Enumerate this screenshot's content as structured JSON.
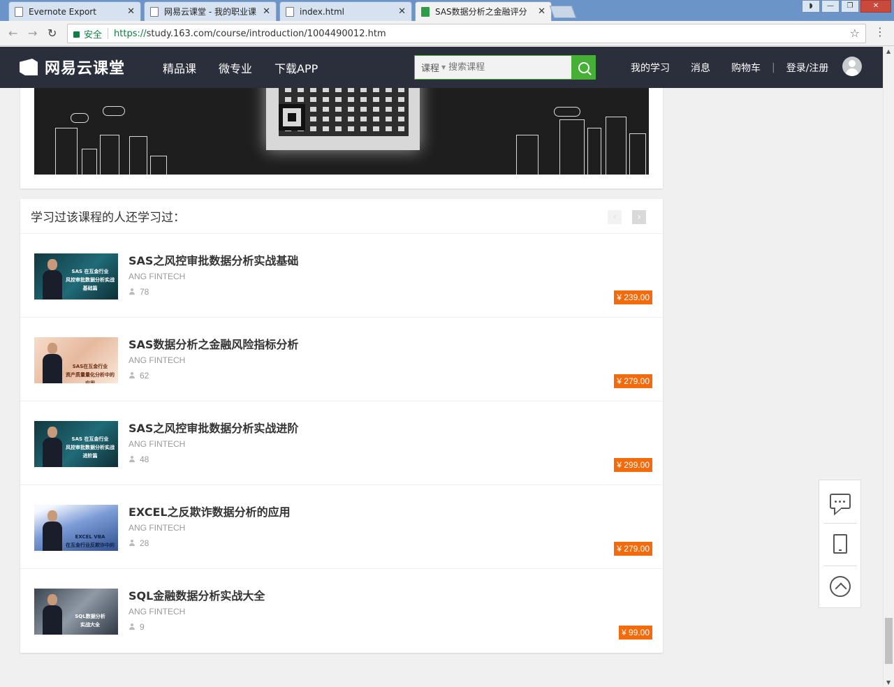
{
  "browser": {
    "tabs": [
      {
        "title": "Evernote Export",
        "active": false
      },
      {
        "title": "网易云课堂 - 我的职业课",
        "active": false
      },
      {
        "title": "index.html",
        "active": false
      },
      {
        "title": "SAS数据分析之金融评分",
        "active": true
      }
    ],
    "omnibox": {
      "secure_label": "安全",
      "url_scheme": "https://",
      "url_rest": "study.163.com/course/introduction/1004490012.htm"
    }
  },
  "site": {
    "logo_text": "网易云课堂",
    "nav": [
      "精品课",
      "微专业",
      "下载APP"
    ],
    "search": {
      "category": "课程",
      "placeholder": "搜索课程"
    },
    "user_nav": {
      "my_learning": "我的学习",
      "messages": "消息",
      "cart": "购物车",
      "divider": "|",
      "login": "登录/注册"
    }
  },
  "related": {
    "title": "学习过该课程的人还学习过：",
    "courses": [
      {
        "title": "SAS之风控审批数据分析实战基础",
        "provider": "ANG FINTECH",
        "learners": "78",
        "price": "¥ 239.00",
        "thumb_lines": [
          "SAS 在互金行业",
          "风控审批数据分析实战",
          "基础篇"
        ]
      },
      {
        "title": "SAS数据分析之金融风险指标分析",
        "provider": "ANG FINTECH",
        "learners": "62",
        "price": "¥ 279.00",
        "thumb_lines": [
          "SAS在互金行业",
          "资产质量量化分析中的应用"
        ]
      },
      {
        "title": "SAS之风控审批数据分析实战进阶",
        "provider": "ANG FINTECH",
        "learners": "48",
        "price": "¥ 299.00",
        "thumb_lines": [
          "SAS 在互金行业",
          "风控审批数据分析实战",
          "进阶篇"
        ]
      },
      {
        "title": "EXCEL之反欺诈数据分析的应用",
        "provider": "ANG FINTECH",
        "learners": "28",
        "price": "¥ 279.00",
        "thumb_lines": [
          "EXCEL VBA",
          "在互金行业反欺诈中的应用"
        ]
      },
      {
        "title": "SQL金融数据分析实战大全",
        "provider": "ANG FINTECH",
        "learners": "9",
        "price": "¥ 99.00",
        "thumb_lines": [
          "SQL数据分析",
          "实战大全"
        ]
      }
    ]
  },
  "colors": {
    "header_bg": "#2a2f3b",
    "accent_green": "#45b035",
    "price_orange": "#f36b0b"
  },
  "icons": [
    "lock-icon",
    "star-icon",
    "menu-icon",
    "search-icon",
    "user-icon",
    "chat-icon",
    "tablet-icon",
    "back-to-top-icon"
  ]
}
